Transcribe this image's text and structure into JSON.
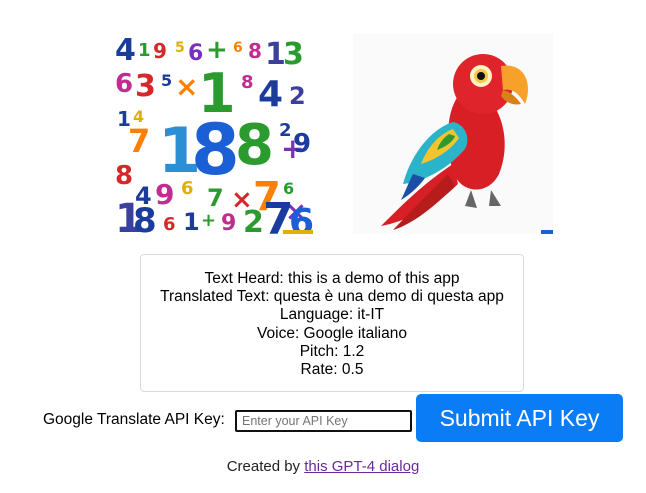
{
  "images": {
    "numbers_image": {
      "name": "colorful-numbers-image"
    },
    "parrot_image": {
      "name": "parrot-image"
    }
  },
  "info": {
    "text_heard": "Text Heard: this is a demo of this app",
    "translated_text": "Translated Text: questa è una demo di questa app",
    "language": "Language: it-IT",
    "voice": "Voice: Google italiano",
    "pitch": "Pitch: 1.2",
    "rate": "Rate: 0.5"
  },
  "api": {
    "label": "Google Translate API Key:",
    "value": "",
    "placeholder": "Enter your API Key",
    "submit_label": "Submit API Key"
  },
  "footer": {
    "prefix": "Created by ",
    "link_text": "this GPT-4 dialog"
  },
  "colors": {
    "button": "#0a7cf5",
    "link": "#6a2a9c",
    "border": "#d9d9d9"
  }
}
